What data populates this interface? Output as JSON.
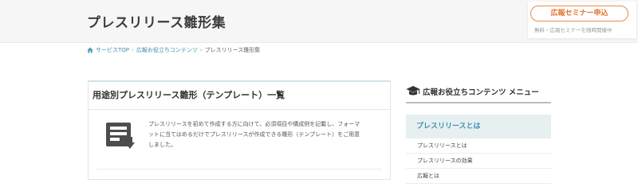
{
  "header": {
    "title": "プレスリリース雛形集"
  },
  "seminar": {
    "button_label": "広報セミナー申込",
    "note": "無料・広報セミナーを随時開催中"
  },
  "breadcrumb": {
    "items": [
      "サービスTOP",
      "広報お役立ちコンテンツ",
      "プレスリリース雛形集"
    ],
    "separator": "›"
  },
  "main_card": {
    "heading": "用途別プレスリリース雛形（テンプレート）一覧",
    "description": "プレスリリースを初めて作成する方に向けて、必須項目や構成例を記載し、フォーマットに当てはめるだけでプレスリリースが作成できる雛形（テンプレート）をご用意しました。",
    "icon": "document-download-icon"
  },
  "sidebar": {
    "title": "広報お役立ちコンテンツ メニュー",
    "title_icon": "graduation-cap-icon",
    "category": "プレスリリースとは",
    "items": [
      "プレスリリースとは",
      "プレスリリースの効果",
      "広報とは"
    ]
  },
  "colors": {
    "accent_orange": "#e2702c",
    "link_blue": "#3f8fb0",
    "category_bg": "#e7f0f1",
    "header_bg": "#f6f6f6"
  }
}
